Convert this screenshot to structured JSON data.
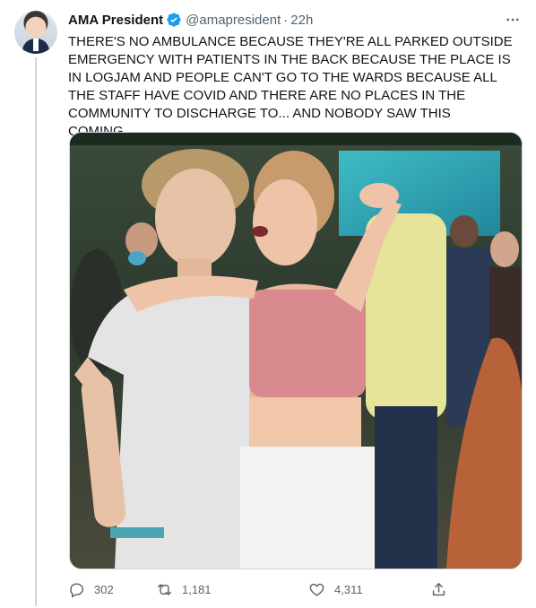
{
  "tweet": {
    "display_name": "AMA President",
    "handle": "@amapresident",
    "separator": "·",
    "time": "22h",
    "text": "THERE'S NO AMBULANCE BECAUSE THEY'RE ALL PARKED OUTSIDE EMERGENCY WITH PATIENTS IN THE BACK BECAUSE THE PLACE IS IN LOGJAM AND PEOPLE CAN'T GO TO THE WARDS BECAUSE ALL THE STAFF HAVE COVID AND THERE ARE NO PLACES IN THE COMMUNITY TO DISCHARGE TO... AND NOBODY SAW THIS COMING...",
    "verified": true
  },
  "actions": {
    "replies": "302",
    "retweets": "1,181",
    "likes": "4,311"
  },
  "icons": {
    "verified": "verified-badge-icon",
    "more": "more-dots-icon",
    "reply": "reply-icon",
    "retweet": "retweet-icon",
    "like": "heart-icon",
    "share": "share-icon"
  },
  "colors": {
    "accent": "#1d9bf0",
    "text": "#0f1419",
    "secondary": "#536471",
    "border": "#cfd9de"
  }
}
